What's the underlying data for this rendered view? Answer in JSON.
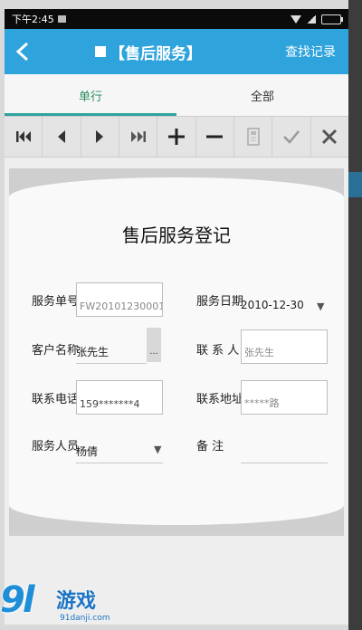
{
  "status_bar": {
    "time": "下午2:45"
  },
  "header": {
    "title": "【售后服务】",
    "history_link": "查找记录"
  },
  "tabs": [
    {
      "label": "单行",
      "active": true
    },
    {
      "label": "全部",
      "active": false
    }
  ],
  "toolbar": [
    {
      "icon": "first-record-icon"
    },
    {
      "icon": "previous-record-icon"
    },
    {
      "icon": "next-record-icon"
    },
    {
      "icon": "last-record-icon"
    },
    {
      "icon": "add-icon"
    },
    {
      "icon": "delete-icon"
    },
    {
      "icon": "save-icon"
    },
    {
      "icon": "confirm-check-icon"
    },
    {
      "icon": "cancel-x-icon"
    }
  ],
  "form": {
    "title": "售后服务登记",
    "service_no": {
      "label": "服务单号",
      "value": "FW20101230001"
    },
    "service_date": {
      "label": "服务日期",
      "value": "2010-12-30"
    },
    "customer_name": {
      "label": "客户名称",
      "value": "张先生",
      "button": "..."
    },
    "contact_person": {
      "label": "联 系 人",
      "value": "张先生"
    },
    "contact_phone": {
      "label": "联系电话",
      "value": "159*******4"
    },
    "contact_address": {
      "label": "联系地址",
      "value": "*****路"
    },
    "service_staff": {
      "label": "服务人员",
      "value": "杨倩"
    },
    "remarks": {
      "label": "备   注",
      "value": ""
    }
  },
  "watermark": {
    "logo": "9l",
    "name": "游戏",
    "url": "91danji.com"
  },
  "colors": {
    "header_bg": "#2ea3dc",
    "tab_active": "#2a8d63",
    "watermark": "#1e8ed8"
  }
}
